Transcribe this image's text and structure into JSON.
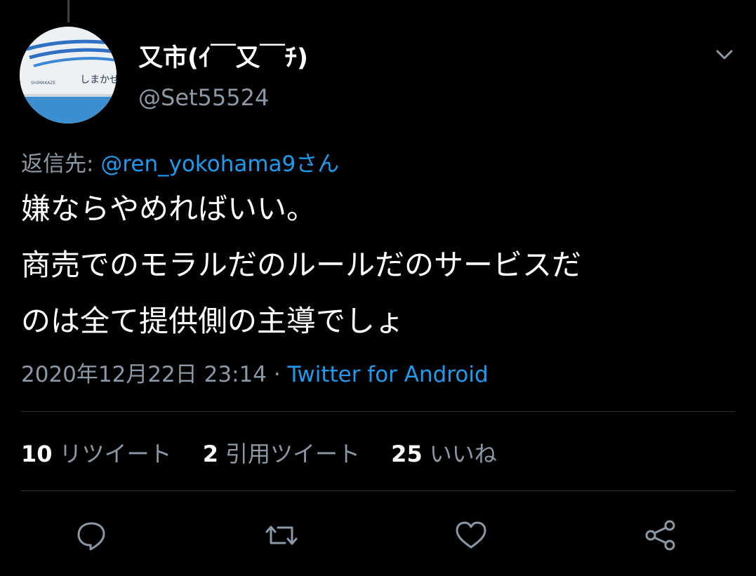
{
  "user": {
    "display_name": "又市(ｲ￣又￣ﾁ)",
    "handle": "@Set55524",
    "avatar_text": "しまかぜ",
    "avatar_subtext": "SHIMAKAZE"
  },
  "reply": {
    "prefix": "返信先: ",
    "mention": "@ren_yokohama9",
    "suffix": "さん"
  },
  "tweet": {
    "lines": [
      "嫌ならやめればいい。",
      "商売でのモラルだのルールだのサービスだ",
      "のは全て提供側の主導でしょ"
    ]
  },
  "meta": {
    "datetime": "2020年12月22日 23:14",
    "separator": " · ",
    "source": "Twitter for Android"
  },
  "stats": {
    "retweets": {
      "count": "10",
      "label": "リツイート"
    },
    "quotes": {
      "count": "2",
      "label": "引用ツイート"
    },
    "likes": {
      "count": "25",
      "label": "いいね"
    }
  },
  "icons": {
    "caret": "chevron-down-icon",
    "reply": "reply-icon",
    "retweet": "retweet-icon",
    "like": "heart-icon",
    "share": "share-icon"
  },
  "colors": {
    "background": "#000000",
    "text": "#ffffff",
    "secondary": "#8b98a5",
    "link": "#1d9bf0",
    "divider": "#2f3336"
  }
}
